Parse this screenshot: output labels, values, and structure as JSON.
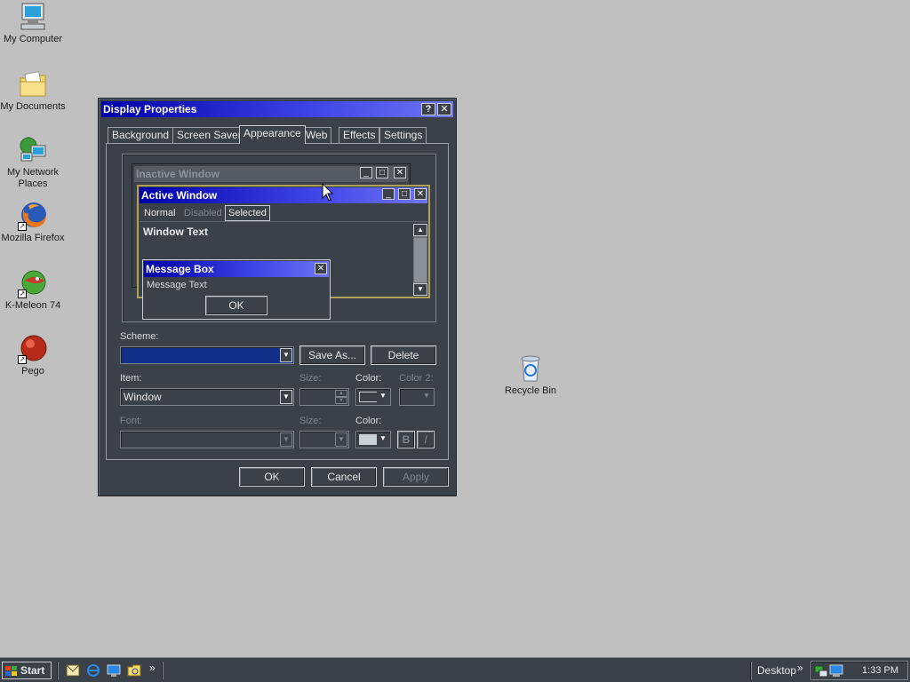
{
  "desktop": {
    "icons": [
      {
        "label": "My Computer",
        "icon": "computer-icon"
      },
      {
        "label": "My Documents",
        "icon": "folder-documents-icon"
      },
      {
        "label_line1": "My Network",
        "label_line2": "Places",
        "icon": "network-icon"
      },
      {
        "label": "Mozilla Firefox",
        "icon": "firefox-icon"
      },
      {
        "label": "K-Meleon 74",
        "icon": "kmeleon-icon"
      },
      {
        "label": "Pego",
        "icon": "pego-icon"
      },
      {
        "label": "Recycle Bin",
        "icon": "recycle-bin-icon"
      }
    ]
  },
  "dialog": {
    "title": "Display Properties",
    "help_glyph": "?",
    "close_glyph": "✕",
    "tabs": [
      "Background",
      "Screen Saver",
      "Appearance",
      "Web",
      "Effects",
      "Settings"
    ],
    "active_tab": "Appearance",
    "preview": {
      "inactive_title": "Inactive Window",
      "active_title": "Active Window",
      "menu_normal": "Normal",
      "menu_disabled": "Disabled",
      "menu_selected": "Selected",
      "window_text": "Window Text",
      "message_box_title": "Message Box",
      "message_text": "Message Text",
      "ok": "OK"
    },
    "scheme_label": "Scheme:",
    "scheme_value": "",
    "save_as": "Save As...",
    "delete": "Delete",
    "item_label": "Item:",
    "item_value": "Window",
    "size_label": "Size:",
    "color_label": "Color:",
    "color2_label": "Color 2:",
    "font_label": "Font:",
    "font_value": "",
    "font_size_label": "Size:",
    "font_color_label": "Color:",
    "bold": "B",
    "italic": "I",
    "ok": "OK",
    "cancel": "Cancel",
    "apply": "Apply"
  },
  "taskbar": {
    "start": "Start",
    "chevron": "»",
    "desktop_toolbar": "Desktop",
    "clock": "1:33 PM"
  },
  "colors": {
    "accent": "#0000a8",
    "dialog_bg": "#3b4149",
    "desktop_bg": "#c0c0c0"
  }
}
